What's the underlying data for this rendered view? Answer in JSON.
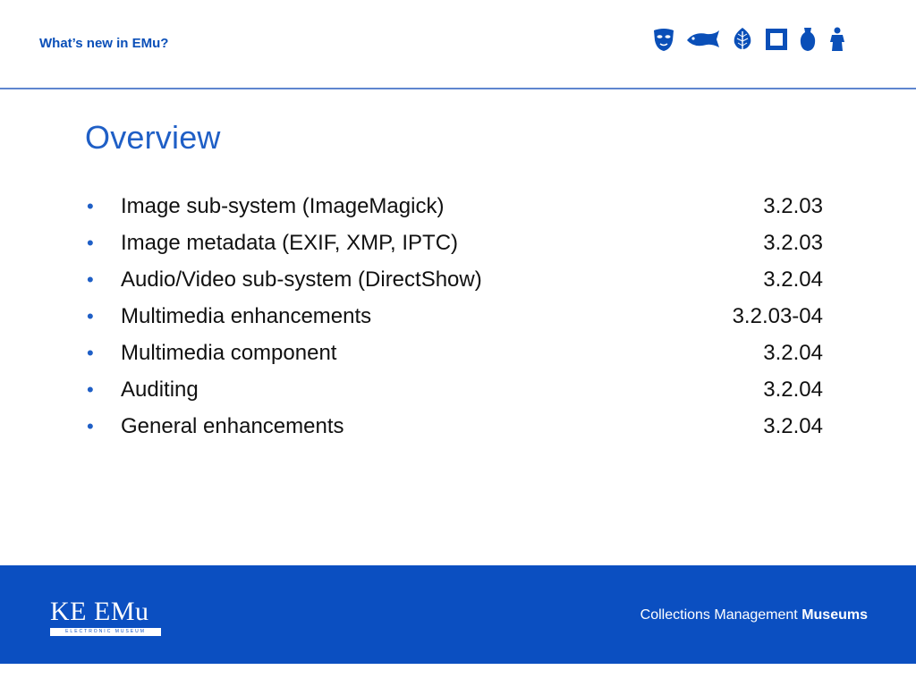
{
  "header": {
    "title": "What’s new in EMu?",
    "icons": [
      "mask-icon",
      "fish-icon",
      "leaf-icon",
      "frame-icon",
      "vase-icon",
      "statue-icon"
    ],
    "accent_color": "#0a4fb8"
  },
  "slide": {
    "title": "Overview",
    "items": [
      {
        "text": "Image sub-system (ImageMagick)",
        "version": "3.2.03"
      },
      {
        "text": "Image metadata (EXIF, XMP, IPTC)",
        "version": "3.2.03"
      },
      {
        "text": "Audio/Video sub-system (DirectShow)",
        "version": "3.2.04"
      },
      {
        "text": "Multimedia enhancements",
        "version": "3.2.03-04"
      },
      {
        "text": "Multimedia component",
        "version": "3.2.04"
      },
      {
        "text": "Auditing",
        "version": "3.2.04"
      },
      {
        "text": "General enhancements",
        "version": "3.2.04"
      }
    ]
  },
  "footer": {
    "logo_text": "KE EMu",
    "logo_subtext": "ELECTRONIC MUSEUM",
    "tagline_regular": "Collections Management",
    "tagline_bold": "Museums",
    "background_color": "#0b4fc1"
  }
}
